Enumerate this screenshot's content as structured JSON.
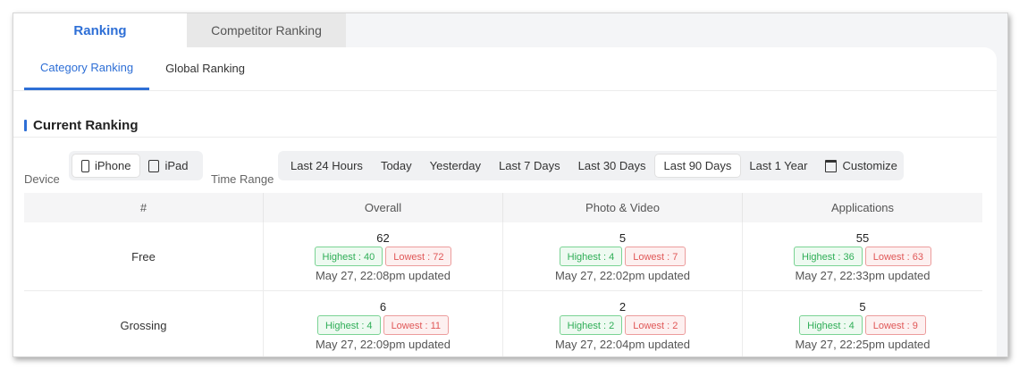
{
  "top_tabs": [
    {
      "label": "Ranking",
      "active": true
    },
    {
      "label": "Competitor Ranking",
      "active": false
    }
  ],
  "sub_tabs": [
    {
      "label": "Category Ranking",
      "active": true
    },
    {
      "label": "Global Ranking",
      "active": false
    }
  ],
  "section_title": "Current Ranking",
  "filters": {
    "device_label": "Device",
    "devices": [
      {
        "label": "iPhone",
        "icon": "phone-icon",
        "selected": true
      },
      {
        "label": "iPad",
        "icon": "tablet-icon",
        "selected": false
      }
    ],
    "time_label": "Time Range",
    "time_ranges": [
      {
        "label": "Last 24 Hours",
        "selected": false
      },
      {
        "label": "Today",
        "selected": false
      },
      {
        "label": "Yesterday",
        "selected": false
      },
      {
        "label": "Last 7 Days",
        "selected": false
      },
      {
        "label": "Last 30 Days",
        "selected": false
      },
      {
        "label": "Last 90 Days",
        "selected": true
      },
      {
        "label": "Last 1 Year",
        "selected": false
      }
    ],
    "customize_label": "Customize",
    "customize_icon": "calendar-icon"
  },
  "table": {
    "headers": [
      "#",
      "Overall",
      "Photo & Video",
      "Applications"
    ],
    "rows": [
      {
        "label": "Free",
        "cells": [
          {
            "rank": "62",
            "highest": "Highest : 40",
            "lowest": "Lowest : 72",
            "updated": "May 27, 22:08pm updated"
          },
          {
            "rank": "5",
            "highest": "Highest : 4",
            "lowest": "Lowest : 7",
            "updated": "May 27, 22:02pm updated"
          },
          {
            "rank": "55",
            "highest": "Highest : 36",
            "lowest": "Lowest : 63",
            "updated": "May 27, 22:33pm updated"
          }
        ]
      },
      {
        "label": "Grossing",
        "cells": [
          {
            "rank": "6",
            "highest": "Highest : 4",
            "lowest": "Lowest : 11",
            "updated": "May 27, 22:09pm updated"
          },
          {
            "rank": "2",
            "highest": "Highest : 2",
            "lowest": "Lowest : 2",
            "updated": "May 27, 22:04pm updated"
          },
          {
            "rank": "5",
            "highest": "Highest : 4",
            "lowest": "Lowest : 9",
            "updated": "May 27, 22:25pm updated"
          }
        ]
      }
    ]
  },
  "colors": {
    "accent": "#2e6fd6",
    "highest": "#2fae57",
    "lowest": "#e05757"
  }
}
